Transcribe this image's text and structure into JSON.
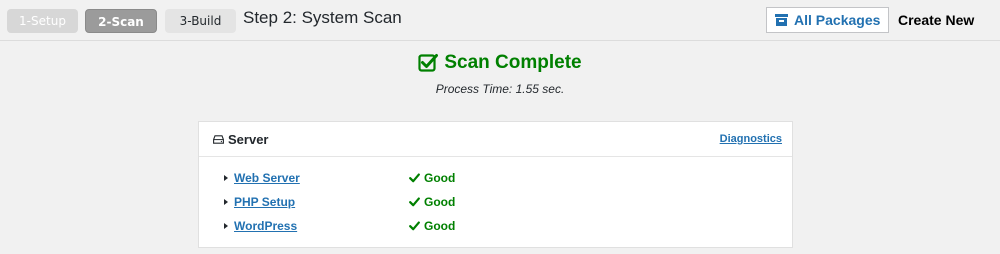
{
  "steps": [
    {
      "label": "1-Setup",
      "state": "done"
    },
    {
      "label": "2-Scan",
      "state": "active"
    },
    {
      "label": "3-Build",
      "state": "pending"
    }
  ],
  "header": {
    "title": "Step 2: System Scan",
    "all_packages_label": "All Packages",
    "all_packages_icon": "archive-icon",
    "create_new_label": "Create New"
  },
  "scan": {
    "title": "Scan Complete",
    "icon": "checkbox-checked-icon",
    "process_time": "Process Time: 1.55 sec."
  },
  "server_panel": {
    "title": "Server",
    "icon": "server-icon",
    "diagnostics_label": "Diagnostics",
    "rows": [
      {
        "label": "Web Server",
        "status": "Good"
      },
      {
        "label": "PHP Setup",
        "status": "Good"
      },
      {
        "label": "WordPress",
        "status": "Good"
      }
    ]
  },
  "colors": {
    "accent": "#2271b1",
    "success": "#008000",
    "background": "#f1f1f1"
  }
}
